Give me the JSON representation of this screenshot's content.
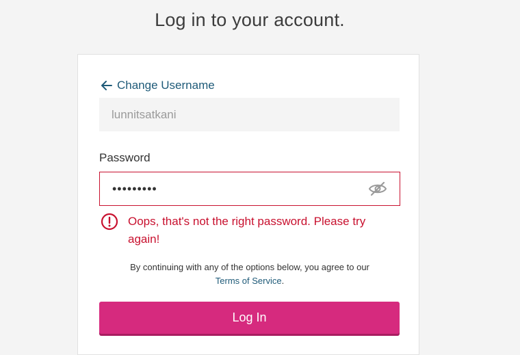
{
  "page": {
    "title": "Log in to your account."
  },
  "form": {
    "change_username_label": "Change Username",
    "username_value": "lunnitsatkani",
    "password_label": "Password",
    "password_masked": "•••••••••",
    "error_message": "Oops, that's not the right password. Please try again!",
    "terms_prefix": "By continuing with any of the options below, you agree to our",
    "terms_link": "Terms of Service",
    "terms_suffix": ".",
    "login_button_label": "Log In"
  },
  "colors": {
    "link": "#1e5a78",
    "error": "#c8102e",
    "primary_button": "#d62a7e"
  },
  "icons": {
    "back": "arrow-left-icon",
    "toggle_password": "eye-slash-icon",
    "error": "exclamation-circle-icon"
  }
}
